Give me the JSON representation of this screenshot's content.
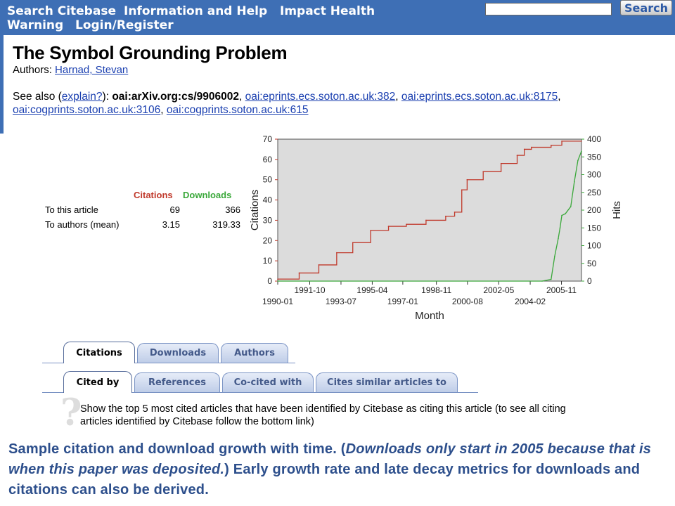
{
  "nav": {
    "items": [
      "Search Citebase",
      "Information and Help",
      "Impact Health",
      "Warning",
      "Login/Register"
    ],
    "search_value": "",
    "search_button": "Search"
  },
  "article": {
    "title": "The Symbol Grounding Problem",
    "authors_label": "Authors:",
    "author": "Harnad, Stevan",
    "see_also_label": "See also (",
    "explain_link": "explain?",
    "see_also_after": "):",
    "primary_id": "oai:arXiv.org:cs/9906002",
    "other_ids": [
      "oai:eprints.ecs.soton.ac.uk:382",
      "oai:eprints.ecs.soton.ac.uk:8175",
      "oai:cogprints.soton.ac.uk:3106",
      "oai:cogprints.soton.ac.uk:615"
    ]
  },
  "stats": {
    "col_citations": "Citations",
    "col_downloads": "Downloads",
    "rows": [
      {
        "label": "To this article",
        "citations": "69",
        "downloads": "366"
      },
      {
        "label": "To authors (mean)",
        "citations": "3.15",
        "downloads": "319.33"
      }
    ]
  },
  "colors": {
    "nav": "#3e6fb5",
    "citations": "#c0392b",
    "downloads": "#3aa83a",
    "plot_bg": "#dcdcdc",
    "caption": "#2d4f8c"
  },
  "chart_data": {
    "type": "line",
    "xlabel": "Month",
    "ylabel_left": "Citations",
    "ylabel_right": "Hits",
    "ylim_left": [
      0,
      70
    ],
    "ylim_right": [
      0,
      400
    ],
    "yticks_left": [
      0,
      10,
      20,
      30,
      40,
      50,
      60,
      70
    ],
    "yticks_right": [
      0,
      50,
      100,
      150,
      200,
      250,
      300,
      350,
      400
    ],
    "x_range": [
      1990.0,
      2007.0
    ],
    "xticks_top": [
      {
        "label": "1991-10",
        "x": 1991.79
      },
      {
        "label": "1995-04",
        "x": 1995.29
      },
      {
        "label": "1998-11",
        "x": 1998.88
      },
      {
        "label": "2002-05",
        "x": 2002.37
      },
      {
        "label": "2005-11",
        "x": 2005.88
      }
    ],
    "xticks_bottom": [
      {
        "label": "1990-01",
        "x": 1990.0
      },
      {
        "label": "1993-07",
        "x": 1993.54
      },
      {
        "label": "1997-01",
        "x": 1997.0
      },
      {
        "label": "2000-08",
        "x": 2000.62
      },
      {
        "label": "2004-02",
        "x": 2004.13
      }
    ],
    "series": [
      {
        "name": "Citations",
        "axis": "left",
        "step": true,
        "x": [
          1990.0,
          1991.2,
          1992.3,
          1993.3,
          1994.2,
          1995.2,
          1996.2,
          1997.2,
          1998.3,
          1999.4,
          1999.9,
          2000.3,
          2000.6,
          2001.5,
          2002.5,
          2003.4,
          2003.8,
          2004.2,
          2005.3,
          2005.9,
          2007.0
        ],
        "y": [
          1,
          4,
          8,
          14,
          19,
          25,
          27,
          28,
          30,
          32,
          34,
          45,
          50,
          54,
          58,
          62,
          65,
          66,
          67,
          69,
          69
        ]
      },
      {
        "name": "Downloads",
        "axis": "right",
        "step": false,
        "x": [
          1990.0,
          2004.8,
          2005.3,
          2005.5,
          2005.7,
          2005.8,
          2005.9,
          2006.1,
          2006.4,
          2006.6,
          2006.8,
          2007.0
        ],
        "y": [
          0,
          0,
          5,
          70,
          120,
          150,
          185,
          190,
          210,
          280,
          340,
          366
        ]
      }
    ]
  },
  "tabs": {
    "row1": [
      "Citations",
      "Downloads",
      "Authors"
    ],
    "row2": [
      "Cited by",
      "References",
      "Co-cited with",
      "Cites similar articles to"
    ]
  },
  "help_mark": "?",
  "description": "Show the top 5 most cited articles that have been identified by Citebase as citing this article (to see all citing articles identified by Citebase follow the bottom link)",
  "caption": {
    "part1": "Sample citation and download growth with time. (",
    "italic": "Downloads only start in 2005 because that is when this paper was deposited.",
    "part2": ") Early growth rate and late decay metrics for downloads and citations can also be derived."
  }
}
